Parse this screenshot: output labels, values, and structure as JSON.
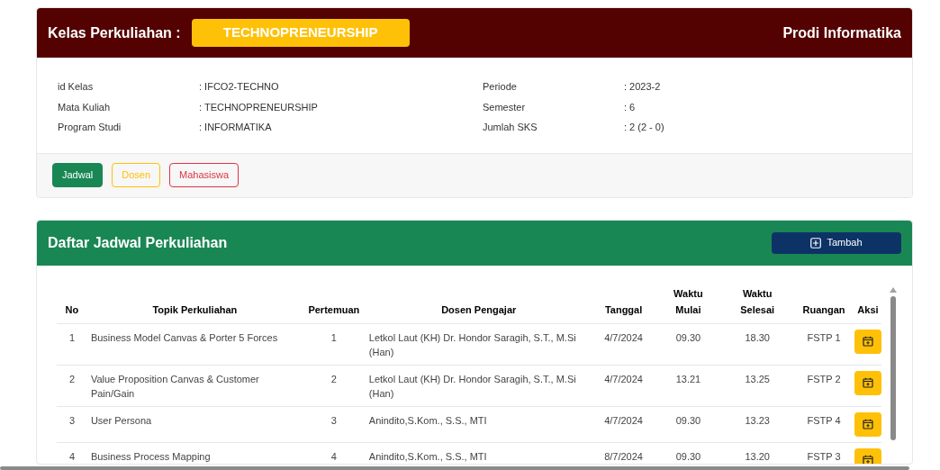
{
  "class_card": {
    "title": "Kelas Perkuliahan :",
    "course_badge": "TECHNOPRENEURSHIP",
    "program": "Prodi Informatika",
    "info_left": [
      {
        "label": "id Kelas",
        "value": ": IFCO2-TECHNO"
      },
      {
        "label": "Mata Kuliah",
        "value": ": TECHNOPRENEURSHIP"
      },
      {
        "label": "Program Studi",
        "value": ": INFORMATIKA"
      }
    ],
    "info_right": [
      {
        "label": "Periode",
        "value": ": 2023-2"
      },
      {
        "label": "Semester",
        "value": ": 6"
      },
      {
        "label": "Jumlah SKS",
        "value": ": 2 (2 - 0)"
      }
    ],
    "tabs": [
      {
        "label": "Jadwal",
        "color": "#198754",
        "selected": true
      },
      {
        "label": "Dosen",
        "color": "#ffc107",
        "selected": false
      },
      {
        "label": "Mahasiswa",
        "color": "#dc3545",
        "selected": false
      }
    ]
  },
  "schedule": {
    "title": "Daftar Jadwal Perkuliahan",
    "add_button": "Tambah",
    "columns": [
      "No",
      "Topik Perkuliahan",
      "Pertemuan",
      "Dosen Pengajar",
      "Tanggal",
      "Waktu Mulai",
      "Waktu Selesai",
      "Ruangan",
      "Aksi"
    ],
    "rows": [
      {
        "no": "1",
        "topic": "Business Model Canvas & Porter 5 Forces",
        "meeting": "1",
        "lecturer": "Letkol Laut (KH) Dr. Hondor Saragih, S.T., M.Si (Han)",
        "date": "4/7/2024",
        "start": "09.30",
        "end": "18.30",
        "room": "FSTP 1"
      },
      {
        "no": "2",
        "topic": "Value Proposition Canvas & Customer Pain/Gain",
        "meeting": "2",
        "lecturer": "Letkol Laut (KH) Dr. Hondor Saragih, S.T., M.Si (Han)",
        "date": "4/7/2024",
        "start": "13.21",
        "end": "13.25",
        "room": "FSTP 2"
      },
      {
        "no": "3",
        "topic": "User Persona",
        "meeting": "3",
        "lecturer": "Anindito,S.Kom., S.S., MTI",
        "date": "4/7/2024",
        "start": "09.30",
        "end": "13.23",
        "room": "FSTP 4"
      },
      {
        "no": "4",
        "topic": "Business Process Mapping",
        "meeting": "4",
        "lecturer": "Anindito,S.Kom., S.S., MTI",
        "date": "8/7/2024",
        "start": "09.30",
        "end": "13.20",
        "room": "FSTP 3"
      }
    ]
  }
}
